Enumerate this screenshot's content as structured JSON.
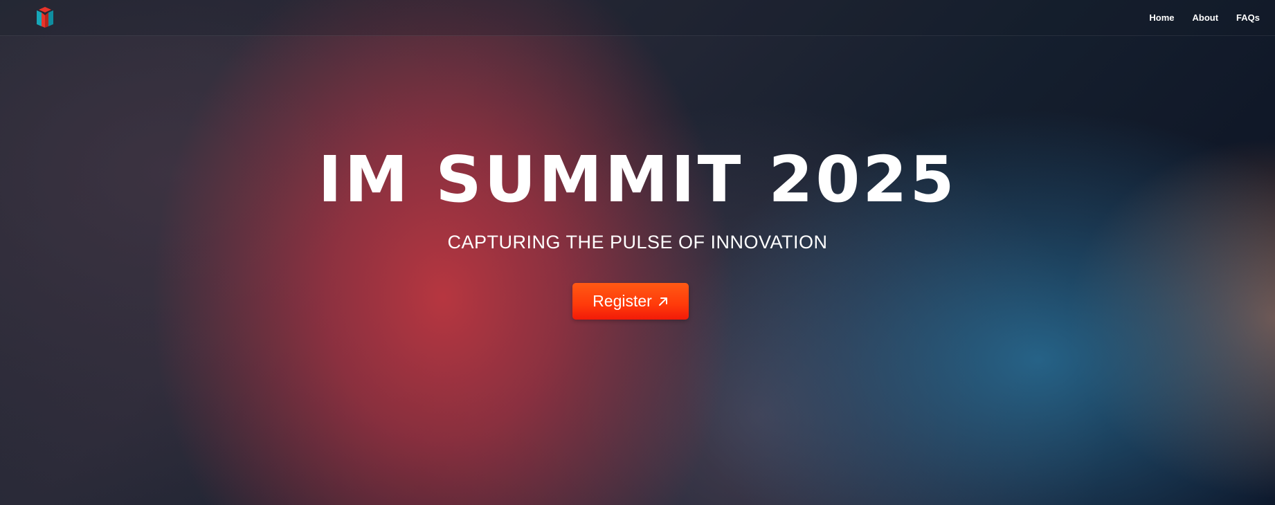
{
  "header": {
    "logo_icon": "cube-m-logo-icon",
    "nav": [
      {
        "label": "Home"
      },
      {
        "label": "About"
      },
      {
        "label": "FAQs"
      }
    ]
  },
  "hero": {
    "title": "IM SUMMIT 2025",
    "subtitle": "CAPTURING THE PULSE OF INNOVATION",
    "register_label": "Register",
    "register_icon": "arrow-up-right-icon"
  },
  "colors": {
    "cta": "#ff4a0f",
    "text": "#ffffff"
  }
}
